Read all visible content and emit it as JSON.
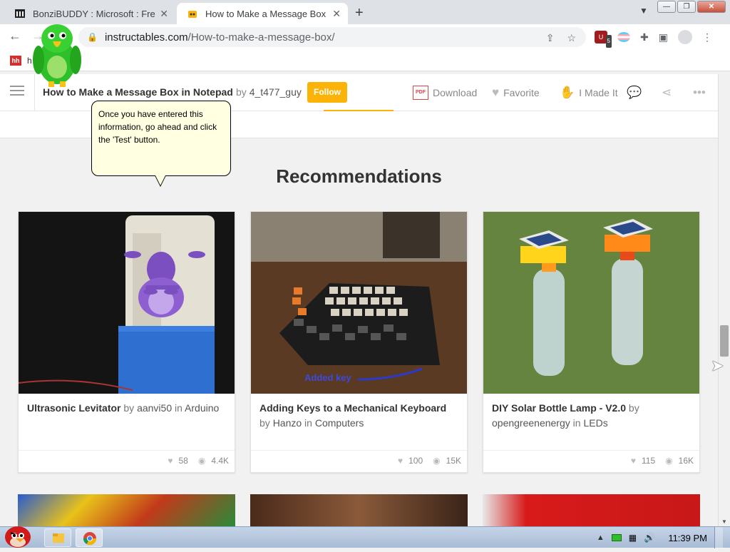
{
  "browser": {
    "tabs": [
      {
        "title": "BonziBUDDY : Microsoft : Free"
      },
      {
        "title": "How to Make a Message Box i"
      }
    ],
    "url_host": "instructables.com",
    "url_path": "/How-to-make-a-message-box/",
    "extension_badge": "5",
    "bookmark_label": "h"
  },
  "instructable_bar": {
    "title": "How to Make a Message Box in Notepad",
    "by": "by",
    "author": "4_t477_guy",
    "follow": "Follow",
    "download": "Download",
    "favorite": "Favorite",
    "made_it": "I Made It"
  },
  "bubble": {
    "text": "Once you have entered this information, go ahead and click the 'Test' button."
  },
  "recommendations": {
    "heading": "Recommendations",
    "cards": [
      {
        "title": "Ultrasonic Levitator",
        "by": "by",
        "author": "aanvi50",
        "in": "in",
        "category": "Arduino",
        "likes": "58",
        "views": "4.4K"
      },
      {
        "title": "Adding Keys to a Mechanical Keyboard",
        "by": "by",
        "author": "Hanzo",
        "in": "in",
        "category": "Computers",
        "likes": "100",
        "views": "15K",
        "image_caption": "Added key"
      },
      {
        "title": "DIY Solar Bottle Lamp - V2.0",
        "by": "by",
        "author": "opengreenenergy",
        "in": "in",
        "category": "LEDs",
        "likes": "115",
        "views": "16K"
      }
    ]
  },
  "taskbar": {
    "clock": "11:39 PM"
  },
  "colors": {
    "follow": "#fab306",
    "bubble": "#ffffe1"
  }
}
